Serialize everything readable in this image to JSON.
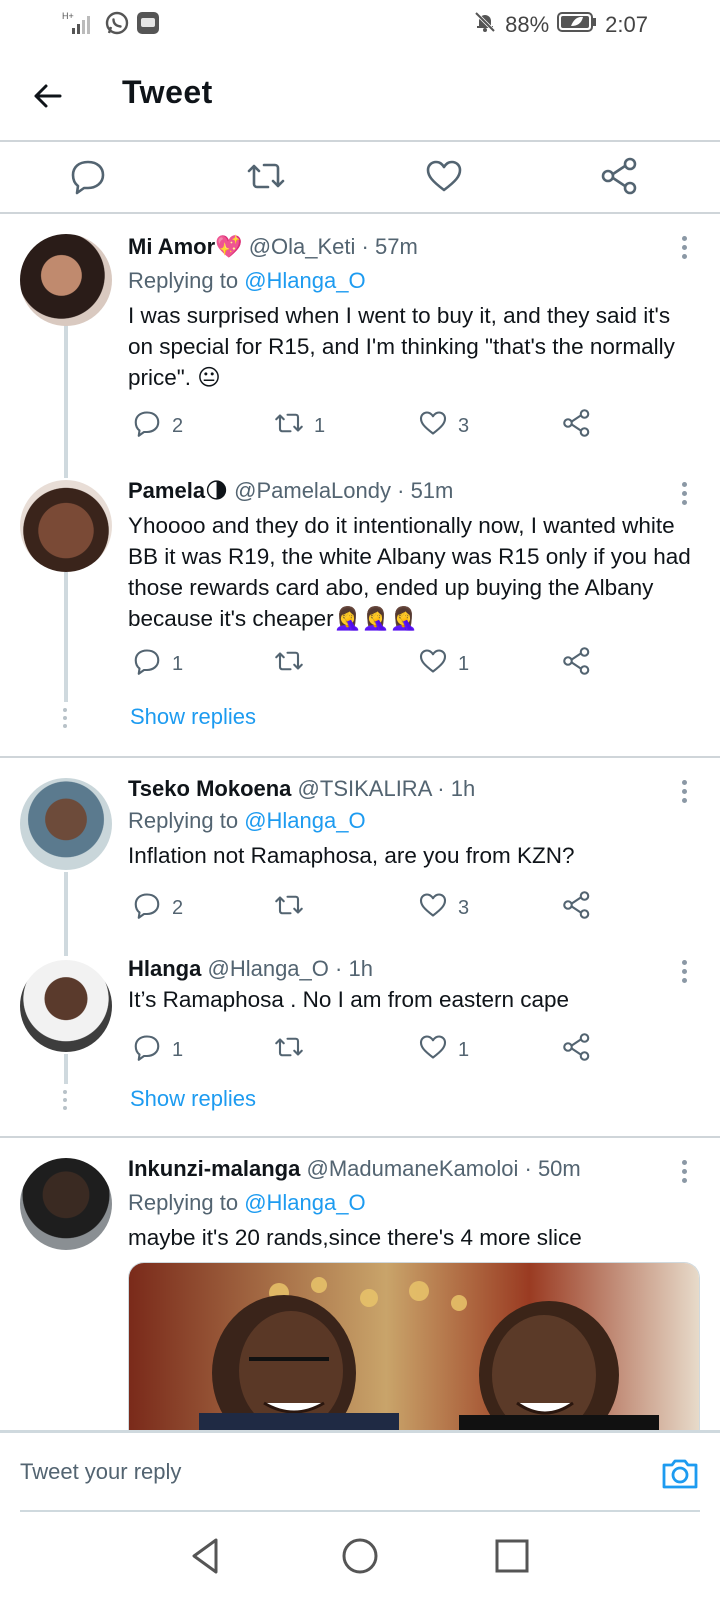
{
  "status_bar": {
    "battery": "88%",
    "time": "2:07"
  },
  "header": {
    "title": "Tweet"
  },
  "tweets": [
    {
      "name": "Mi Amor💖",
      "handle": "@Ola_Keti",
      "time": "· 57m",
      "replying_prefix": "Replying to",
      "replying_to": "@Hlanga_O",
      "text": "I was surprised when I went to buy it, and they said it's on special for R15, and I'm thinking \"that's the normally price\". 😐",
      "replies": "2",
      "retweets": "1",
      "likes": "3"
    },
    {
      "name": "Pamela🌗",
      "handle": "@PamelaLondy",
      "time": "· 51m",
      "text": "Yhoooo and they do it intentionally now, I wanted white BB it was R19, the white Albany was R15 only if you had those rewards card abo, ended up buying the Albany because it's cheaper🤦‍♀️🤦‍♀️🤦‍♀️",
      "replies": "1",
      "retweets": "",
      "likes": "1"
    },
    {
      "name": "Tseko Mokoena",
      "handle": "@TSIKALIRA",
      "time": "· 1h",
      "replying_prefix": "Replying to",
      "replying_to": "@Hlanga_O",
      "text": "Inflation not Ramaphosa, are you from KZN?",
      "replies": "2",
      "retweets": "",
      "likes": "3"
    },
    {
      "name": "Hlanga",
      "handle": "@Hlanga_O",
      "time": "· 1h",
      "text": "It’s Ramaphosa . No I am from eastern cape",
      "replies": "1",
      "retweets": "",
      "likes": "1"
    },
    {
      "name": "Inkunzi-malanga",
      "handle": "@MadumaneKamoloi",
      "time": "· 50m",
      "replying_prefix": "Replying to",
      "replying_to": "@Hlanga_O",
      "text": "maybe it's 20 rands,since there's 4 more slice"
    }
  ],
  "show_replies_label": "Show replies",
  "composer": {
    "placeholder": "Tweet your reply"
  },
  "icons": {
    "reply": "comment-icon",
    "retweet": "retweet-icon",
    "like": "heart-icon",
    "share": "share-icon"
  },
  "colors": {
    "accent": "#1d9bf0",
    "muted": "#536471"
  }
}
